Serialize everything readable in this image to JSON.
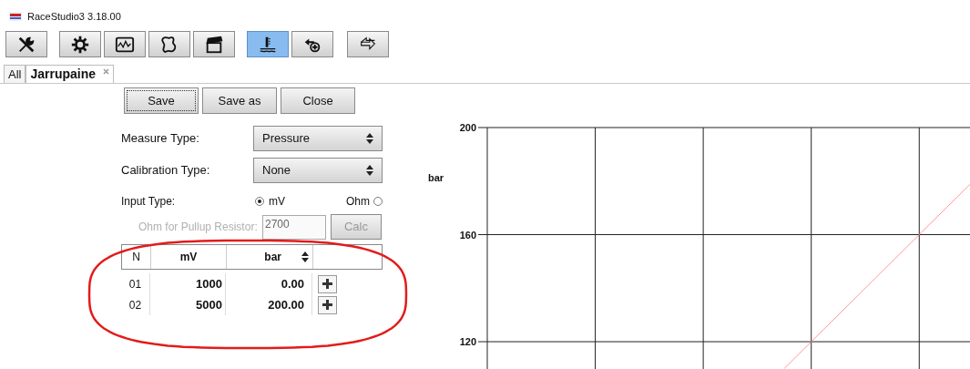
{
  "window": {
    "title": "RaceStudio3 3.18.00"
  },
  "toolbar": [
    {
      "kind": "wrench",
      "selected": false
    },
    {
      "kind": "gear",
      "selected": false
    },
    {
      "kind": "monitor",
      "selected": false
    },
    {
      "kind": "track",
      "selected": false
    },
    {
      "kind": "clapper",
      "selected": false
    },
    {
      "kind": "thermo",
      "selected": true
    },
    {
      "kind": "arrow-plus",
      "selected": false
    },
    {
      "kind": "swap",
      "selected": false
    }
  ],
  "tabs": [
    {
      "label": "All",
      "selected": false,
      "closable": false
    },
    {
      "label": "Jarrupaine",
      "selected": true,
      "closable": true
    }
  ],
  "buttons": [
    {
      "label": "Save",
      "focused": true
    },
    {
      "label": "Save as",
      "focused": false
    },
    {
      "label": "Close",
      "focused": false
    }
  ],
  "measure_type": {
    "label": "Measure Type:",
    "value": "Pressure"
  },
  "calibration_type": {
    "label": "Calibration Type:",
    "value": "None"
  },
  "input_type": {
    "label": "Input Type:",
    "options": [
      {
        "label": "mV",
        "selected": true
      },
      {
        "label": "Ohm",
        "selected": false
      }
    ]
  },
  "pullup": {
    "label": "Ohm for Pullup Resistor:",
    "value": "2700",
    "button": "Calc",
    "disabled": true
  },
  "table": {
    "columns": [
      "N",
      "mV",
      "bar"
    ],
    "rows": [
      {
        "n": "01",
        "mv": "1000",
        "bar": "0.00"
      },
      {
        "n": "02",
        "mv": "5000",
        "bar": "200.00"
      }
    ]
  },
  "highlight": {
    "color": "#e31b1b"
  },
  "plot": {
    "ylabel": "bar",
    "yticks": [
      "200",
      "160",
      "120"
    ]
  }
}
